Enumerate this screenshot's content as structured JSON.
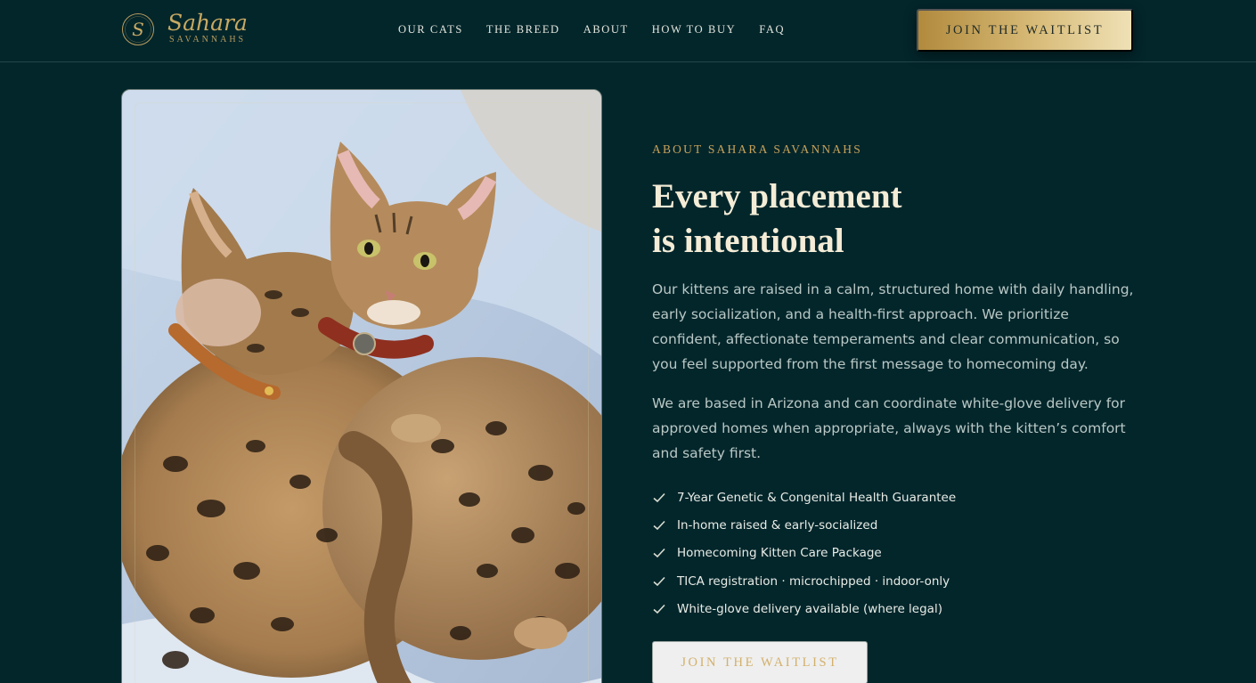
{
  "brand": {
    "script_name": "Sahara",
    "sub_name": "SAVANNAHS",
    "monogram": "S",
    "gold": "#c8a963"
  },
  "nav": {
    "items": [
      {
        "label": "OUR CATS"
      },
      {
        "label": "THE BREED"
      },
      {
        "label": "ABOUT"
      },
      {
        "label": "HOW TO BUY"
      },
      {
        "label": "FAQ"
      }
    ],
    "cta_label": "JOIN THE WAITLIST"
  },
  "about": {
    "eyebrow": "ABOUT SAHARA SAVANNAHS",
    "headline_line1": "Every placement",
    "headline_line2": "is intentional",
    "paragraph1": "Our kittens are raised in a calm, structured home with daily handling, early socialization, and a health-first approach. We prioritize confident, affectionate temperaments and clear communication, so you feel supported from the first message to homecoming day.",
    "paragraph2": "We are based in Arizona and can coordinate white-glove delivery for approved homes when appropriate, always with the kitten’s comfort and safety first.",
    "features": [
      "7-Year Genetic & Congenital Health Guarantee",
      "In-home raised & early-socialized",
      "Homecoming Kitten Care Package",
      "TICA registration · microchipped · indoor-only",
      "White-glove delivery available (where legal)"
    ],
    "cta_label": "JOIN THE WAITLIST",
    "photo_subject": "two-savannah-kittens-cuddling"
  },
  "colors": {
    "background": "#03262b",
    "accent_gold": "#c8a25a",
    "headline": "#f4ecd6"
  }
}
